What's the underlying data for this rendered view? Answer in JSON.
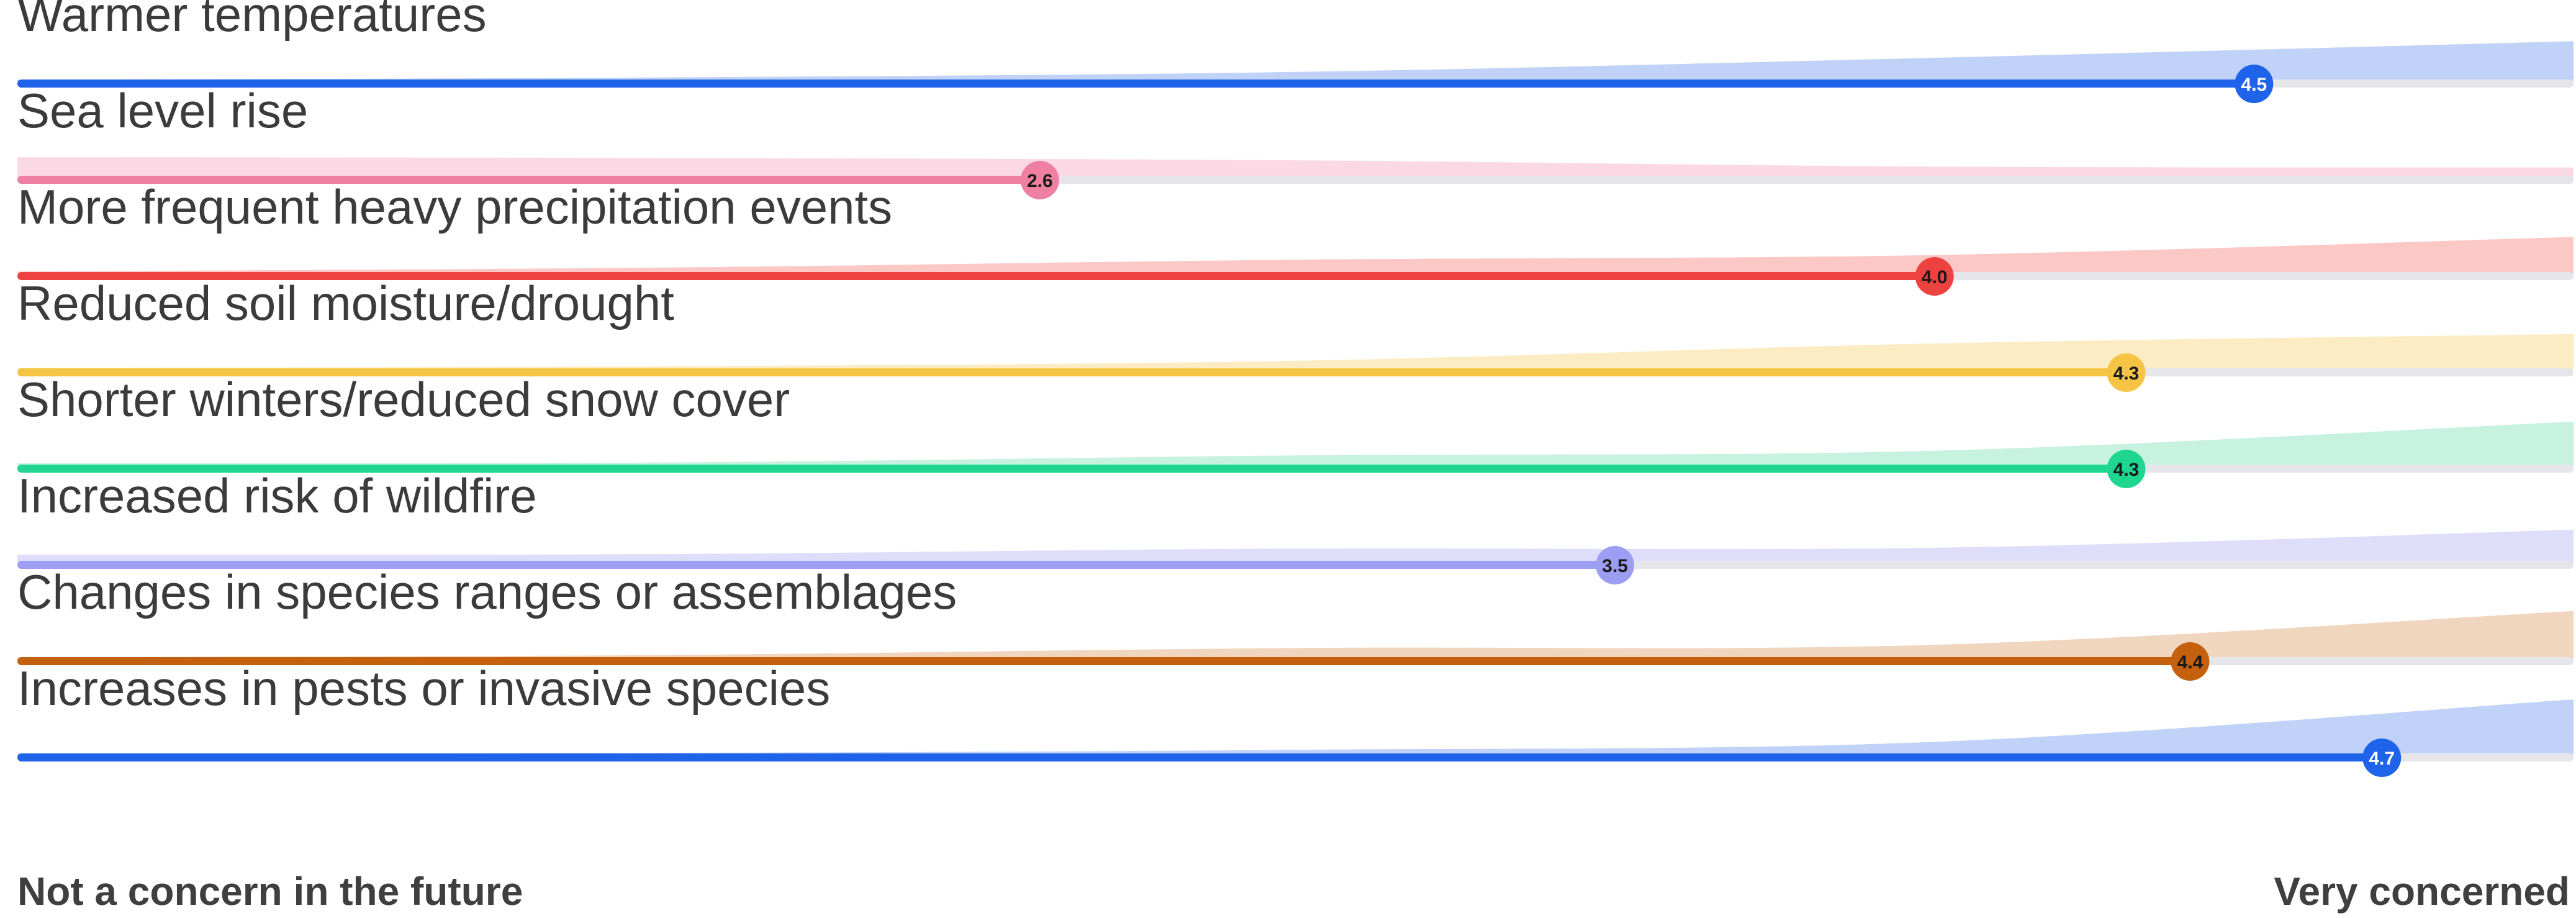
{
  "chart_data": {
    "type": "bar",
    "xlim": [
      1,
      5
    ],
    "categories": [
      "Warmer temperatures",
      "Sea level rise",
      "More frequent heavy precipitation events",
      "Reduced soil moisture/drought",
      "Shorter winters/reduced snow cover",
      "Increased risk of wildfire",
      "Changes in species ranges or assemblages",
      "Increases in pests or invasive species"
    ],
    "values": [
      4.5,
      2.6,
      4.0,
      4.3,
      4.3,
      3.5,
      4.4,
      4.7
    ],
    "value_labels": [
      "4.5",
      "2.6",
      "4.0",
      "4.3",
      "4.3",
      "3.5",
      "4.4",
      "4.7"
    ],
    "distribution_shares": [
      [
        0.02,
        0.05,
        0.12,
        0.3,
        0.51
      ],
      [
        0.26,
        0.25,
        0.22,
        0.14,
        0.13
      ],
      [
        0.03,
        0.08,
        0.18,
        0.24,
        0.47
      ],
      [
        0.03,
        0.05,
        0.12,
        0.34,
        0.46
      ],
      [
        0.04,
        0.05,
        0.14,
        0.2,
        0.57
      ],
      [
        0.1,
        0.11,
        0.18,
        0.19,
        0.42
      ],
      [
        0.02,
        0.05,
        0.14,
        0.18,
        0.61
      ],
      [
        0.02,
        0.03,
        0.07,
        0.17,
        0.71
      ]
    ],
    "colors": [
      "#1f63ea",
      "#ef7fa3",
      "#ee4240",
      "#f6c445",
      "#1ed68f",
      "#9b9ef3",
      "#c5600f",
      "#1f63ea"
    ],
    "shade_colors": [
      "#bdd0f7",
      "#fbd7e3",
      "#fbc5c3",
      "#fcebc1",
      "#c3f1dd",
      "#dcdcfa",
      "#efd3bc",
      "#bdd0f7"
    ],
    "track_color": "#e6e6ea",
    "badge_text_colors": [
      "#ffffff",
      "#1a1a1a",
      "#1a1a1a",
      "#1a1a1a",
      "#1a1a1a",
      "#1a1a1a",
      "#1a1a1a",
      "#ffffff"
    ],
    "xlabel_left": "Not a concern in the future",
    "xlabel_right": "Very concerned"
  }
}
